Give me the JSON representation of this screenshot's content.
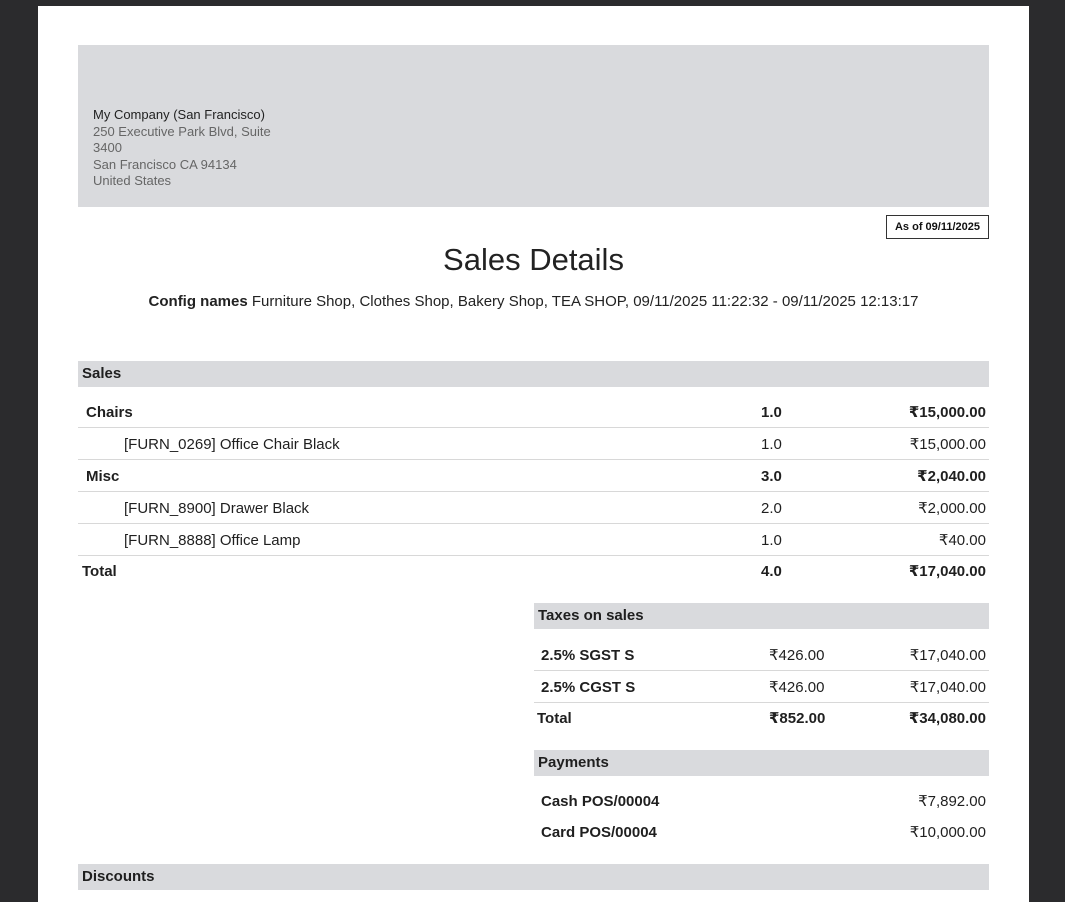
{
  "company": {
    "name": "My Company (San Francisco)",
    "address_lines": [
      "250 Executive Park Blvd, Suite",
      "3400",
      "San Francisco CA 94134",
      "United States"
    ]
  },
  "as_of": "As of 09/11/2025",
  "title": "Sales Details",
  "config": {
    "label": "Config names",
    "value": "Furniture Shop, Clothes Shop, Bakery Shop, TEA SHOP, 09/11/2025 11:22:32 - 09/11/2025 12:13:17"
  },
  "sales": {
    "heading": "Sales",
    "rows": [
      {
        "name": "Chairs",
        "qty": "1.0",
        "amount": "₹15,000.00",
        "level": "category"
      },
      {
        "name": "[FURN_0269] Office Chair Black",
        "qty": "1.0",
        "amount": "₹15,000.00",
        "level": "product"
      },
      {
        "name": "Misc",
        "qty": "3.0",
        "amount": "₹2,040.00",
        "level": "category"
      },
      {
        "name": "[FURN_8900] Drawer Black",
        "qty": "2.0",
        "amount": "₹2,000.00",
        "level": "product"
      },
      {
        "name": "[FURN_8888] Office Lamp",
        "qty": "1.0",
        "amount": "₹40.00",
        "level": "product"
      }
    ],
    "total": {
      "label": "Total",
      "qty": "4.0",
      "amount": "₹17,040.00"
    }
  },
  "taxes": {
    "heading": "Taxes on sales",
    "rows": [
      {
        "name": "2.5% SGST S",
        "tax": "₹426.00",
        "base": "₹17,040.00"
      },
      {
        "name": "2.5% CGST S",
        "tax": "₹426.00",
        "base": "₹17,040.00"
      }
    ],
    "total": {
      "label": "Total",
      "tax": "₹852.00",
      "base": "₹34,080.00"
    }
  },
  "payments": {
    "heading": "Payments",
    "rows": [
      {
        "name": "Cash POS/00004",
        "amount": "₹7,892.00"
      },
      {
        "name": "Card POS/00004",
        "amount": "₹10,000.00"
      }
    ]
  },
  "discounts": {
    "heading": "Discounts"
  }
}
